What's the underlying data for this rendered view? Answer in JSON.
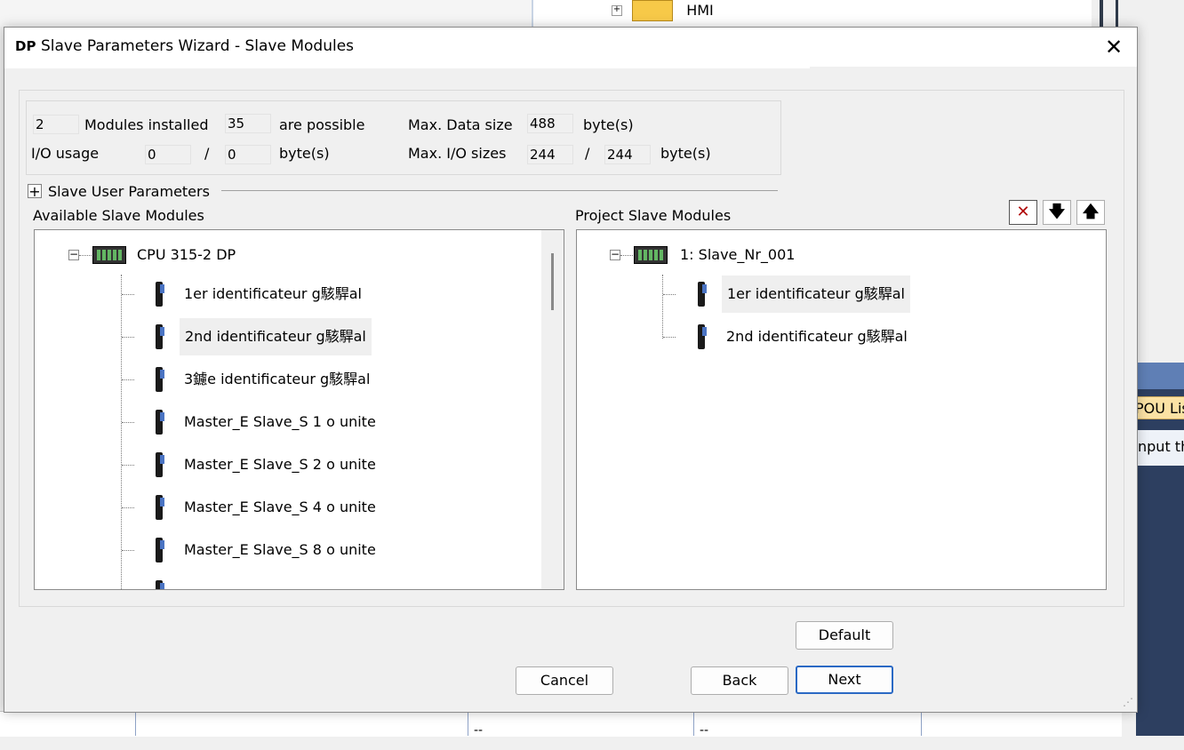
{
  "background": {
    "tree_item": "HMI",
    "right_tab": "POU Lis",
    "right_input": "nput th",
    "bottom_cells": [
      "--",
      "--"
    ]
  },
  "dialog": {
    "title_icon": "DP",
    "title": "Slave Parameters Wizard - Slave Modules",
    "close_label": "✕"
  },
  "info": {
    "modules_installed_value": "2",
    "modules_installed_label": "Modules installed",
    "possible_value": "35",
    "possible_label": "are possible",
    "max_data_size_label": "Max. Data size",
    "max_data_size_value": "488",
    "bytes_label": "byte(s)",
    "io_usage_label": "I/O usage",
    "io_usage_in": "0",
    "io_usage_slash": "/",
    "io_usage_out": "0",
    "max_io_sizes_label": "Max. I/O sizes",
    "max_io_in": "244",
    "max_io_slash": "/",
    "max_io_out": "244"
  },
  "user_params": {
    "expand_symbol": "+",
    "label": "Slave User Parameters"
  },
  "available": {
    "label": "Available Slave Modules",
    "root": "CPU 315-2 DP",
    "items": [
      "1er identificateur g駭駻al",
      "2nd identificateur g駭駻al",
      "3鑢e identificateur g駭駻al",
      "Master_E Slave_S  1 o unite",
      "Master_E Slave_S  2 o unite",
      "Master_E Slave_S  4 o unite",
      "Master_E Slave_S  8 o unite"
    ]
  },
  "project": {
    "label": "Project Slave Modules",
    "root": "1: Slave_Nr_001",
    "items": [
      "1er identificateur g駭駻al",
      "2nd identificateur g駭駻al"
    ]
  },
  "toolbar": {
    "delete_symbol": "✕",
    "down_symbol": "🡇",
    "up_symbol": "🡅"
  },
  "buttons": {
    "default": "Default",
    "cancel": "Cancel",
    "back": "Back",
    "next": "Next"
  },
  "tree_symbols": {
    "collapse": "−"
  }
}
